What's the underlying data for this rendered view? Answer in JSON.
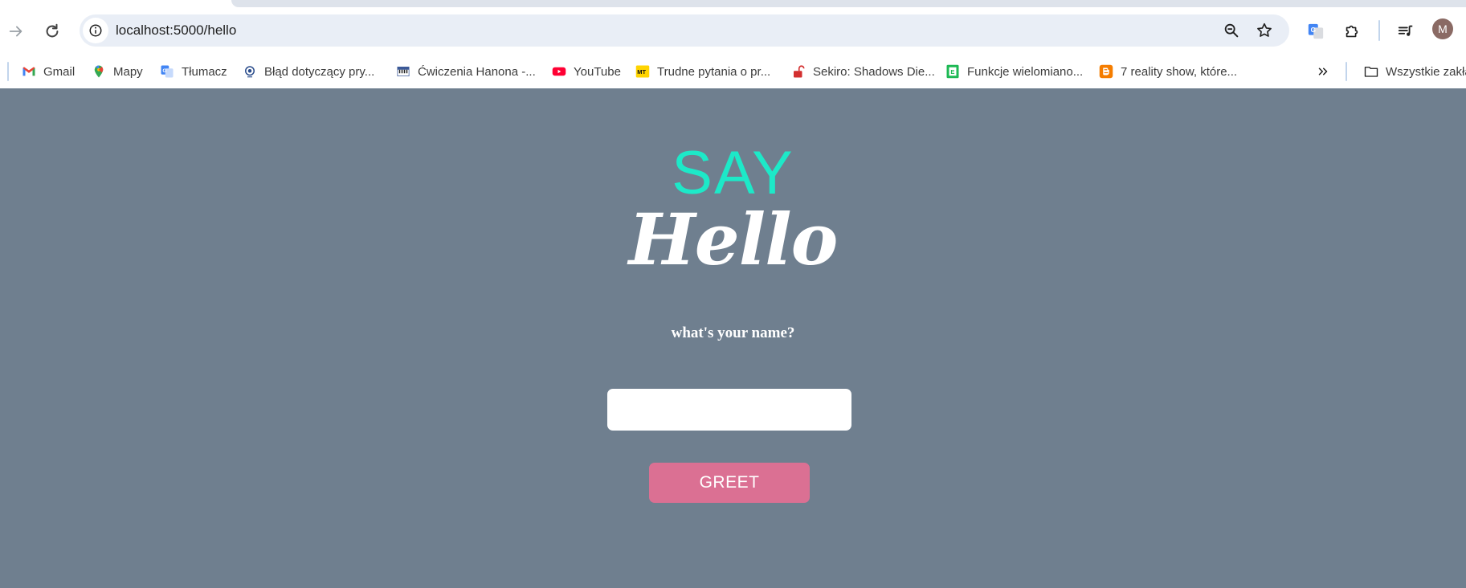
{
  "browser": {
    "url": "localhost:5000/hello",
    "profile_initial": "M"
  },
  "bookmarks": [
    {
      "label": "Gmail",
      "icon": "gmail-icon"
    },
    {
      "label": "Mapy",
      "icon": "maps-icon"
    },
    {
      "label": "Tłumacz",
      "icon": "translate-icon"
    },
    {
      "label": "Błąd dotyczący pry...",
      "icon": "site-logo-icon"
    },
    {
      "label": "Ćwiczenia Hanona -...",
      "icon": "piano-icon"
    },
    {
      "label": "YouTube",
      "icon": "youtube-icon"
    },
    {
      "label": "Trudne pytania o pr...",
      "icon": "mt-icon"
    },
    {
      "label": "Sekiro: Shadows Die...",
      "icon": "lock-icon"
    },
    {
      "label": "Funkcje wielomiano...",
      "icon": "e-book-icon"
    },
    {
      "label": "7 reality show, które...",
      "icon": "blogger-icon"
    }
  ],
  "bookmarks_overflow_label": "Wszystkie zakła",
  "page": {
    "title_top": "SAY",
    "title_bottom": "Hello",
    "prompt": "what's your name?",
    "input_value": "",
    "button_label": "GREET"
  },
  "colors": {
    "page_background": "#6f7f8f",
    "say_color": "#1de9c8",
    "button_color": "#db7093"
  }
}
